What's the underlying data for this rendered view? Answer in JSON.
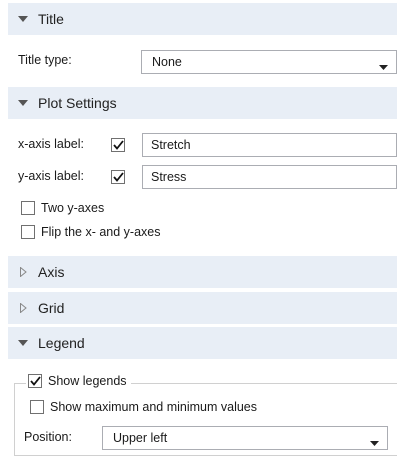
{
  "sections": {
    "title": {
      "label": "Title",
      "expanded": true
    },
    "plot_settings": {
      "label": "Plot Settings",
      "expanded": true
    },
    "axis": {
      "label": "Axis",
      "expanded": false
    },
    "grid": {
      "label": "Grid",
      "expanded": false
    },
    "legend": {
      "label": "Legend",
      "expanded": true
    }
  },
  "title_settings": {
    "type_label": "Title type:",
    "type_value": "None"
  },
  "plot_settings": {
    "x_axis_label": "x-axis label:",
    "x_axis_checked": true,
    "x_axis_value": "Stretch",
    "y_axis_label": "y-axis label:",
    "y_axis_checked": true,
    "y_axis_value": "Stress",
    "two_y_axes": {
      "label": "Two y-axes",
      "checked": false
    },
    "flip_axes": {
      "label": "Flip the x- and y-axes",
      "checked": false
    }
  },
  "legend_settings": {
    "show_legends": {
      "label": "Show legends",
      "checked": true
    },
    "show_max_min": {
      "label": "Show maximum and minimum values",
      "checked": false
    },
    "position_label": "Position:",
    "position_value": "Upper left"
  },
  "icons": {
    "expanded": "triangle-down-icon",
    "collapsed": "triangle-right-icon",
    "check": "checkmark-icon",
    "dropdown": "chevron-down-icon"
  },
  "colors": {
    "section_bg": "#e8eef6",
    "input_border": "#abadb3"
  }
}
